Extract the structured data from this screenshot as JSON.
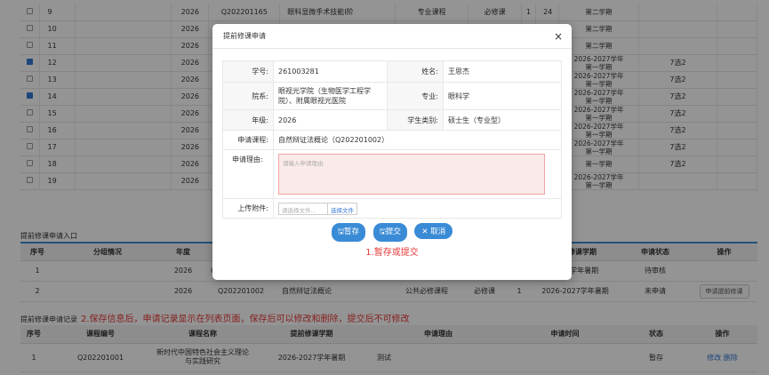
{
  "bg_rows": [
    {
      "no": "9",
      "checked": false,
      "year": "2026",
      "code": "Q202201165",
      "name": "眼科显微手术技能I阶",
      "ctype": "专业课程",
      "req": "必修课",
      "credit": "1",
      "hours": "24",
      "term": "第二学期",
      "status": ""
    },
    {
      "no": "10",
      "checked": false,
      "year": "2026",
      "code": "",
      "name": "",
      "ctype": "",
      "req": "",
      "credit": "",
      "hours": "8",
      "term": "第二学期",
      "status": ""
    },
    {
      "no": "11",
      "checked": false,
      "year": "2026",
      "code": "",
      "name": "",
      "ctype": "",
      "req": "",
      "credit": "",
      "hours": "4",
      "term": "第二学期",
      "status": ""
    },
    {
      "no": "12",
      "checked": true,
      "year": "2026",
      "code": "",
      "name": "",
      "ctype": "",
      "req": "",
      "credit": "",
      "hours": "2",
      "term": "2026-2027学年\n第一学期",
      "status": "7选2"
    },
    {
      "no": "13",
      "checked": false,
      "year": "2026",
      "code": "",
      "name": "",
      "ctype": "",
      "req": "",
      "credit": "",
      "hours": "0",
      "term": "2026-2027学年\n第一学期",
      "status": "7选2"
    },
    {
      "no": "14",
      "checked": true,
      "year": "2026",
      "code": "",
      "name": "",
      "ctype": "",
      "req": "",
      "credit": "",
      "hours": "2",
      "term": "2026-2027学年\n第一学期",
      "status": "7选2"
    },
    {
      "no": "15",
      "checked": false,
      "year": "2026",
      "code": "",
      "name": "",
      "ctype": "",
      "req": "",
      "credit": "",
      "hours": "8",
      "term": "2026-2027学年\n第一学期",
      "status": "7选2"
    },
    {
      "no": "16",
      "checked": false,
      "year": "2026",
      "code": "",
      "name": "",
      "ctype": "",
      "req": "",
      "credit": "",
      "hours": "0",
      "term": "2026-2027学年\n第一学期",
      "status": "7选2"
    },
    {
      "no": "17",
      "checked": false,
      "year": "2026",
      "code": "",
      "name": "",
      "ctype": "",
      "req": "",
      "credit": "",
      "hours": "2",
      "term": "2026-2027学年\n第一学期",
      "status": "7选2"
    },
    {
      "no": "18",
      "checked": false,
      "year": "2026",
      "code": "",
      "name": "",
      "ctype": "",
      "req": "",
      "credit": "",
      "hours": "2",
      "term": "第一学期",
      "status": "7选2"
    },
    {
      "no": "19",
      "checked": false,
      "year": "2026",
      "code": "",
      "name": "",
      "ctype": "",
      "req": "",
      "credit": "",
      "hours": "6",
      "term": "2026-2027学年\n第一学期",
      "status": ""
    }
  ],
  "entry_section": {
    "title": "提前修课申请入口",
    "headers": [
      "序号",
      "分组情况",
      "年度",
      "",
      "",
      "",
      "",
      "",
      "提前修课学期",
      "申请状态",
      "操作"
    ],
    "rows": [
      {
        "no": "1",
        "group": "",
        "year": "2026",
        "code": "Q",
        "name": "",
        "ctype": "",
        "req": "",
        "credit": "",
        "term": "2027学年暑期",
        "status": "待审核",
        "op": ""
      },
      {
        "no": "2",
        "group": "",
        "year": "2026",
        "code": "Q202201002",
        "name": "自然辩证法概论",
        "ctype": "公共必修课程",
        "req": "必修课",
        "credit": "1",
        "term": "2026-2027学年暑期",
        "status": "未申请",
        "op": "申请提前修课"
      }
    ]
  },
  "record_section": {
    "title": "提前修课申请记录",
    "note": "2.保存信息后，申请记录显示在列表页面，保存后可以修改和删除，提交后不可修改",
    "headers": [
      "序号",
      "课程编号",
      "课程名称",
      "提前修课学期",
      "申请理由",
      "申请时间",
      "状态",
      "操作"
    ],
    "rows": [
      {
        "no": "1",
        "code": "Q202201001",
        "name": "新时代中国特色社会主义理论\n与实践研究",
        "term": "2026-2027学年暑期",
        "reason": "测试",
        "time": "",
        "status": "暂存",
        "edit": "修改",
        "delete": "删除"
      }
    ]
  },
  "modal": {
    "title": "提前修课申请",
    "close": "×",
    "student_no_label": "学号:",
    "student_no": "261003281",
    "name_label": "姓名:",
    "name": "王思杰",
    "dept_label": "院系:",
    "dept": "眼视光学院（生物医学工程学院）、附属眼视光医院",
    "major_label": "专业:",
    "major": "眼科学",
    "grade_label": "年级:",
    "grade": "2026",
    "category_label": "学生类别:",
    "category": "硕士生（专业型）",
    "course_label": "申请课程:",
    "course": "自然辩证法概论（Q202201002）",
    "reason_label": "申请理由:",
    "reason_placeholder": "请输入申请理由",
    "attach_label": "上传附件:",
    "attach_placeholder": "请选择文件...",
    "attach_button": "选择文件",
    "save_label": "暂存",
    "submit_label": "提交",
    "cancel_label": "取消",
    "note": "1.暂存或提交"
  }
}
